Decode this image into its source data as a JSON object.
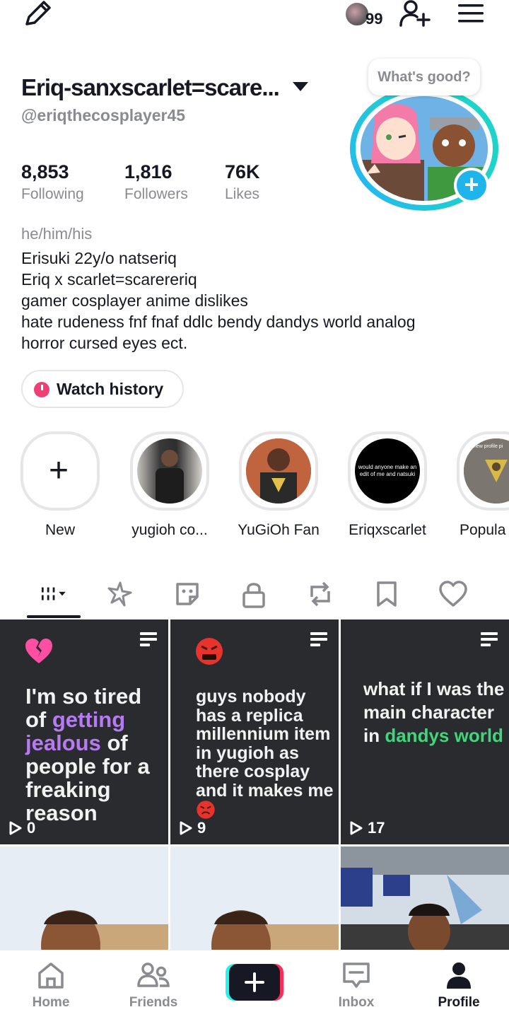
{
  "topbar": {
    "notification_count": "99"
  },
  "profile": {
    "display_name": "Eriq-sanxscarlet=scare...",
    "handle": "@eriqthecosplayer45",
    "bubble_text": "What's good?",
    "stats": [
      {
        "value": "8,853",
        "label": "Following"
      },
      {
        "value": "1,816",
        "label": "Followers"
      },
      {
        "value": "76K",
        "label": "Likes"
      }
    ],
    "pronouns": "he/him/his",
    "bio_lines": [
      "Erisuki 22y/o natseriq",
      "Eriq x scarlet=scarereriq",
      "gamer cosplayer anime dislikes",
      "hate rudeness fnf fnaf ddlc bendy dandys world analog",
      "horror cursed eyes ect."
    ],
    "watch_history_label": "Watch history"
  },
  "highlights": [
    {
      "label": "New"
    },
    {
      "label": "yugioh co..."
    },
    {
      "label": "YuGiOh Fan"
    },
    {
      "label": "Eriqxscarlet",
      "thumb_text": "would anyone make an edit of me and natsuki"
    },
    {
      "label": "Popula",
      "thumb_text": "new profile pi"
    }
  ],
  "tabs": [
    "videos",
    "reposts-spark",
    "stickers",
    "private",
    "repost",
    "saved",
    "liked"
  ],
  "posts": [
    {
      "caption_parts": [
        "I'm so tired of ",
        "getting jealous",
        " of people for a freaking reason"
      ],
      "views": "0",
      "emoji": "broken-heart-icon"
    },
    {
      "caption": "guys nobody has a replica millennium item in yugioh as there cosplay and it makes me",
      "views": "9",
      "emoji": "angry-face-icon"
    },
    {
      "caption_parts": [
        "what if I was the main character in ",
        "dandys world"
      ],
      "views": "17"
    }
  ],
  "bottom_nav": [
    {
      "label": "Home"
    },
    {
      "label": "Friends"
    },
    {
      "label": ""
    },
    {
      "label": "Inbox"
    },
    {
      "label": "Profile"
    }
  ],
  "colors": {
    "accent_teal": "#1ed3c8",
    "accent_blue": "#20b4ec",
    "highlight_purple": "#b67bf2",
    "highlight_green": "#40d77b",
    "history_pink": "#ef3f75"
  }
}
